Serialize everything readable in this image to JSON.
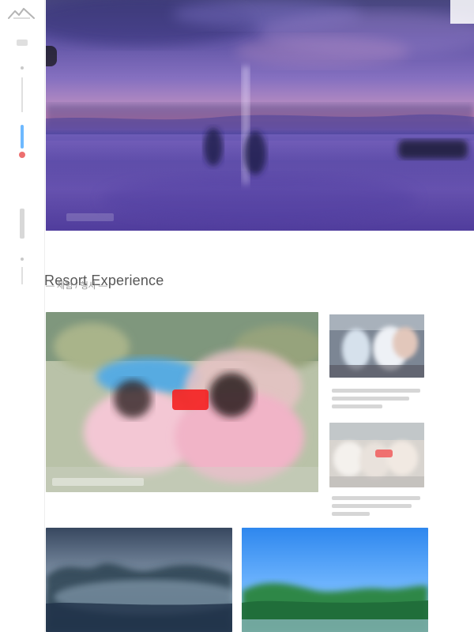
{
  "page": {
    "title": "Resort Experience",
    "subtitle": "— 체험 / 행사 —"
  },
  "sidebar": {
    "logo_icon": "mountain-logo-icon"
  },
  "hero": {
    "caption": "",
    "play_icon": "play-icon"
  },
  "cards": {
    "main": {
      "caption": ""
    },
    "top_right": {
      "caption_lines": [
        "",
        "",
        ""
      ]
    },
    "bottom_right": {
      "caption_lines": [
        "",
        "",
        ""
      ]
    }
  },
  "colors": {
    "accent_blue": "#4aa8ff",
    "accent_red": "#e84b4b"
  }
}
